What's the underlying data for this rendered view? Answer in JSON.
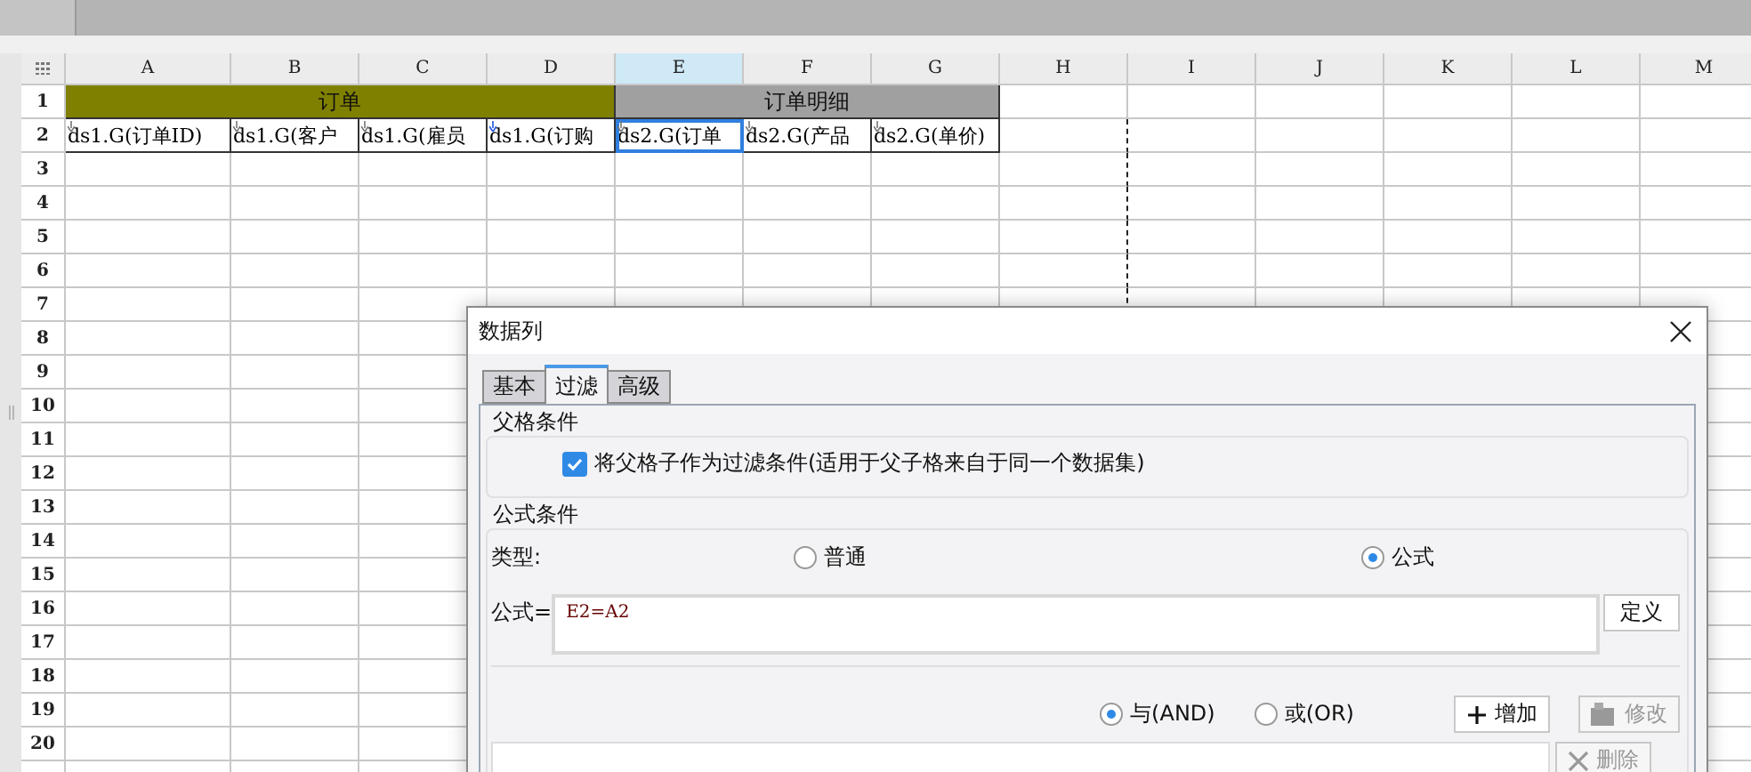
{
  "sheet": {
    "columns": [
      {
        "label": "A",
        "selected": false
      },
      {
        "label": "B",
        "selected": false
      },
      {
        "label": "C",
        "selected": false
      },
      {
        "label": "D",
        "selected": false
      },
      {
        "label": "E",
        "selected": true
      },
      {
        "label": "F",
        "selected": false
      },
      {
        "label": "G",
        "selected": false
      },
      {
        "label": "H",
        "selected": false
      },
      {
        "label": "I",
        "selected": false
      },
      {
        "label": "J",
        "selected": false
      },
      {
        "label": "K",
        "selected": false
      },
      {
        "label": "L",
        "selected": false
      },
      {
        "label": "M",
        "selected": false
      }
    ],
    "rows": [
      "1",
      "2",
      "3",
      "4",
      "5",
      "6",
      "7",
      "8",
      "9",
      "10",
      "11",
      "12",
      "13",
      "14",
      "15",
      "16",
      "17",
      "18",
      "19",
      "20"
    ],
    "header_groups": [
      {
        "label": "订单",
        "color": "#808000"
      },
      {
        "label": "订单明细",
        "color": "#a0a0a0"
      }
    ],
    "data_cells": [
      {
        "text": "ds1.G(订单ID)",
        "selected": false
      },
      {
        "text": "ds1.G(客户",
        "selected": false
      },
      {
        "text": "ds1.G(雇员",
        "selected": false
      },
      {
        "text": "ds1.G(订购",
        "selected": false
      },
      {
        "text": "ds2.G(订单",
        "selected": true
      },
      {
        "text": "ds2.G(产品",
        "selected": false
      },
      {
        "text": "ds2.G(单价)",
        "selected": false
      }
    ]
  },
  "dialog": {
    "title": "数据列",
    "tabs": [
      {
        "label": "基本",
        "selected": false
      },
      {
        "label": "过滤",
        "selected": true
      },
      {
        "label": "高级",
        "selected": false
      }
    ],
    "parent_condition": {
      "title": "父格条件",
      "checkbox": {
        "label": "将父格子作为过滤条件(适用于父子格来自于同一个数据集)",
        "checked": true
      }
    },
    "formula_condition": {
      "title": "公式条件",
      "type_label": "类型:",
      "type_options": [
        {
          "label": "普通",
          "selected": false
        },
        {
          "label": "公式",
          "selected": true
        }
      ],
      "formula_label": "公式=",
      "formula_value": "E2=A2",
      "define_button": "定义",
      "logic_options": [
        {
          "label": "与(AND)",
          "selected": true
        },
        {
          "label": "或(OR)",
          "selected": false
        }
      ],
      "buttons": [
        {
          "label": "增加",
          "kind": "add",
          "disabled": false
        },
        {
          "label": "修改",
          "kind": "edit",
          "disabled": true
        },
        {
          "label": "删除",
          "kind": "delete",
          "disabled": true
        }
      ]
    }
  }
}
